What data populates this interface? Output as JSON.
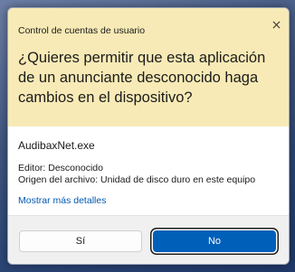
{
  "dialog": {
    "caption": "Control de cuentas de usuario",
    "question": "¿Quieres permitir que esta aplicación de un anunciante desconocido haga cambios en el dispositivo?",
    "app_name": "AudibaxNet.exe",
    "publisher": "Editor: Desconocido",
    "origin": "Origen del archivo: Unidad de disco duro en este equipo",
    "details_link": "Mostrar más detalles",
    "yes_label": "Sí",
    "no_label": "No",
    "close_icon": "close-icon"
  },
  "colors": {
    "header_background": "#f8eab6",
    "primary_button": "#005fb8",
    "link": "#0059b3"
  }
}
